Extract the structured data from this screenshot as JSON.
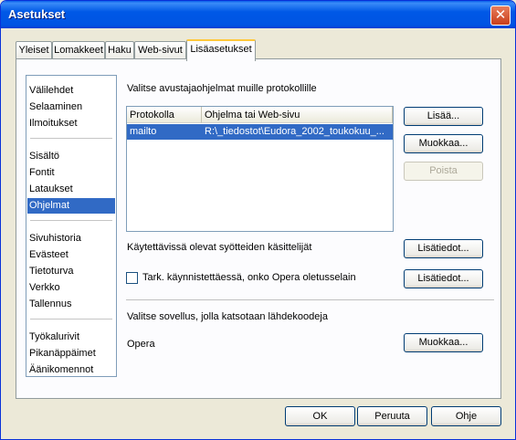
{
  "window": {
    "title": "Asetukset",
    "close_glyph": "✕"
  },
  "tabs": [
    {
      "label": "Yleiset"
    },
    {
      "label": "Lomakkeet"
    },
    {
      "label": "Haku"
    },
    {
      "label": "Web-sivut"
    },
    {
      "label": "Lisäasetukset"
    }
  ],
  "sidebar": {
    "items": [
      {
        "label": "Välilehdet"
      },
      {
        "label": "Selaaminen"
      },
      {
        "label": "Ilmoitukset"
      },
      {
        "label": "Sisältö"
      },
      {
        "label": "Fontit"
      },
      {
        "label": "Lataukset"
      },
      {
        "label": "Ohjelmat"
      },
      {
        "label": "Sivuhistoria"
      },
      {
        "label": "Evästeet"
      },
      {
        "label": "Tietoturva"
      },
      {
        "label": "Verkko"
      },
      {
        "label": "Tallennus"
      },
      {
        "label": "Työkalurivit"
      },
      {
        "label": "Pikanäppäimet"
      },
      {
        "label": "Äänikomennot"
      }
    ],
    "selected": "Ohjelmat"
  },
  "main": {
    "protocols_heading": "Valitse avustajaohjelmat muille protokollille",
    "table": {
      "headers": [
        "Protokolla",
        "Ohjelma tai Web-sivu"
      ],
      "rows": [
        [
          "mailto",
          "R:\\_tiedostot\\Eudora_2002_toukokuu_..."
        ]
      ]
    },
    "buttons": {
      "add": "Lisää...",
      "edit": "Muokkaa...",
      "remove": "Poista"
    },
    "feeds_label": "Käytettävissä olevat syötteiden käsittelijät",
    "feeds_button": "Lisätiedot...",
    "default_check_label": "Tark. käynnistettäessä, onko Opera oletusselain",
    "default_check_button": "Lisätiedot...",
    "source_heading": "Valitse sovellus, jolla katsotaan lähdekoodeja",
    "source_app": "Opera",
    "source_button": "Muokkaa..."
  },
  "footer": {
    "ok": "OK",
    "cancel": "Peruuta",
    "help": "Ohje"
  }
}
